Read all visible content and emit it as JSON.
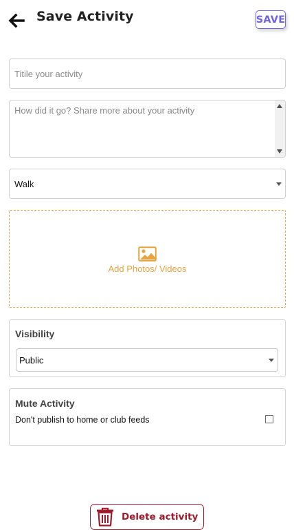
{
  "header": {
    "title": "Save Activity",
    "save_label": "SAVE",
    "back_icon": "arrow-left-icon"
  },
  "form": {
    "title_placeholder": "Titile your activity",
    "title_value": "",
    "description_placeholder": "How did it go? Share more about your activity",
    "description_value": "",
    "activity_type": "Walk"
  },
  "media": {
    "icon": "image-icon",
    "label": "Add Photos/ Videos"
  },
  "visibility": {
    "title": "Visibility",
    "selected": "Public"
  },
  "mute": {
    "title": "Mute Activity",
    "description": "Don't publish to home or club feeds",
    "checked": false
  },
  "delete": {
    "label": "Delete activity",
    "icon": "trash-icon"
  },
  "colors": {
    "accent": "#6c63e8",
    "upload": "#e8a33d",
    "danger": "#a1192b"
  }
}
